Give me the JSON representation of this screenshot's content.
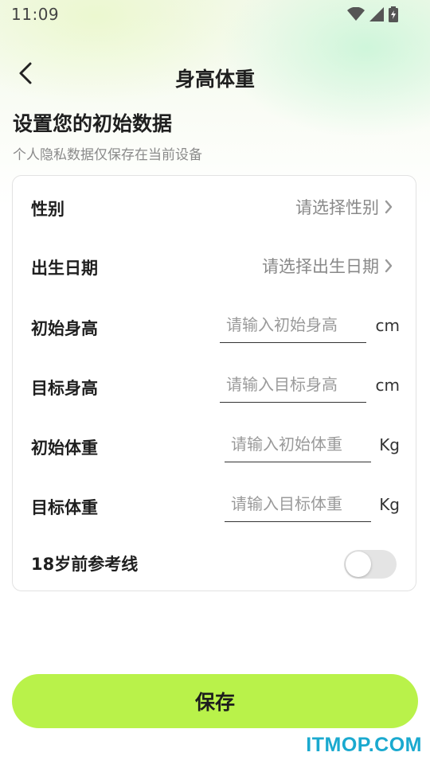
{
  "status_bar": {
    "time": "11:09",
    "icons": [
      "wifi-icon",
      "cellular-signal-icon",
      "battery-charging-icon"
    ]
  },
  "header": {
    "back_icon": "chevron-left-icon",
    "title": "身高体重"
  },
  "intro": {
    "heading": "设置您的初始数据",
    "subheading": "个人隐私数据仅保存在当前设备"
  },
  "form": {
    "gender": {
      "label": "性别",
      "placeholder": "请选择性别",
      "icon": "chevron-right-icon"
    },
    "birthdate": {
      "label": "出生日期",
      "placeholder": "请选择出生日期",
      "icon": "chevron-right-icon"
    },
    "initial_height": {
      "label": "初始身高",
      "placeholder": "请输入初始身高",
      "value": "",
      "unit": "cm"
    },
    "target_height": {
      "label": "目标身高",
      "placeholder": "请输入目标身高",
      "value": "",
      "unit": "cm"
    },
    "initial_weight": {
      "label": "初始体重",
      "placeholder": "请输入初始体重",
      "value": "",
      "unit": "Kg"
    },
    "target_weight": {
      "label": "目标体重",
      "placeholder": "请输入目标体重",
      "value": "",
      "unit": "Kg"
    },
    "reference_line": {
      "label": "18岁前参考线",
      "enabled": false
    }
  },
  "actions": {
    "save_label": "保存"
  },
  "watermark": "ITMOP.COM",
  "colors": {
    "accent": "#b9f24a",
    "watermark": "#1aa9cf",
    "toggle_off": "#e4e4e4"
  }
}
